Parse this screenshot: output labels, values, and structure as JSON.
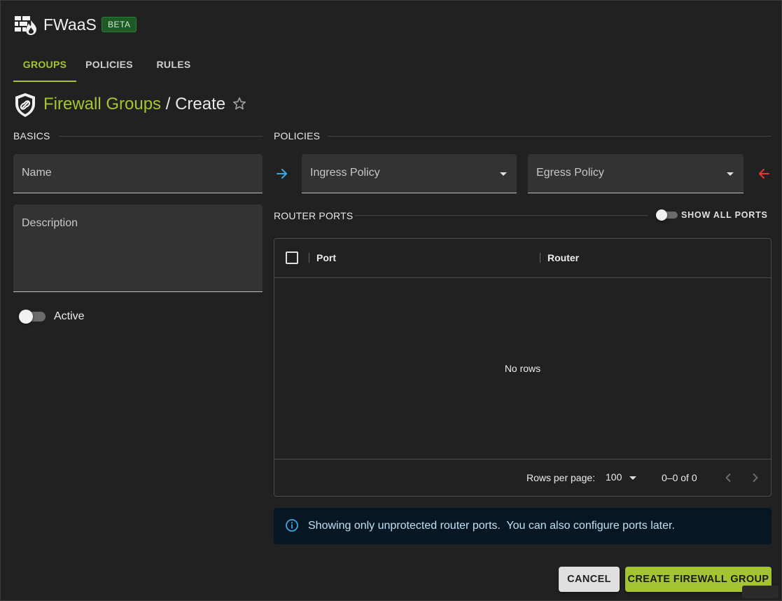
{
  "header": {
    "app_title": "FWaaS",
    "badge": "BETA"
  },
  "tabs": [
    {
      "label": "GROUPS",
      "active": true
    },
    {
      "label": "POLICIES",
      "active": false
    },
    {
      "label": "RULES",
      "active": false
    }
  ],
  "breadcrumb": {
    "parent": "Firewall Groups",
    "separator": "/",
    "current": "Create"
  },
  "basics": {
    "title": "BASICS",
    "name_label": "Name",
    "description_label": "Description",
    "active_label": "Active",
    "active_on": false
  },
  "policies": {
    "title": "POLICIES",
    "ingress_label": "Ingress Policy",
    "egress_label": "Egress Policy"
  },
  "router_ports": {
    "title": "ROUTER PORTS",
    "show_all_label": "SHOW ALL PORTS",
    "show_all_on": false,
    "columns": [
      "Port",
      "Router"
    ],
    "empty_text": "No rows",
    "rows_per_page_label": "Rows per page:",
    "rows_per_page": "100",
    "pagination": "0–0 of 0"
  },
  "info": {
    "text": "Showing only unprotected router ports.  You can also configure ports later."
  },
  "actions": {
    "cancel": "CANCEL",
    "create": "CREATE FIREWALL GROUP"
  },
  "colors": {
    "accent": "#a4c531",
    "ingress_arrow": "#3aa8e0",
    "egress_arrow": "#e53935",
    "info_icon": "#3aa8e0"
  }
}
